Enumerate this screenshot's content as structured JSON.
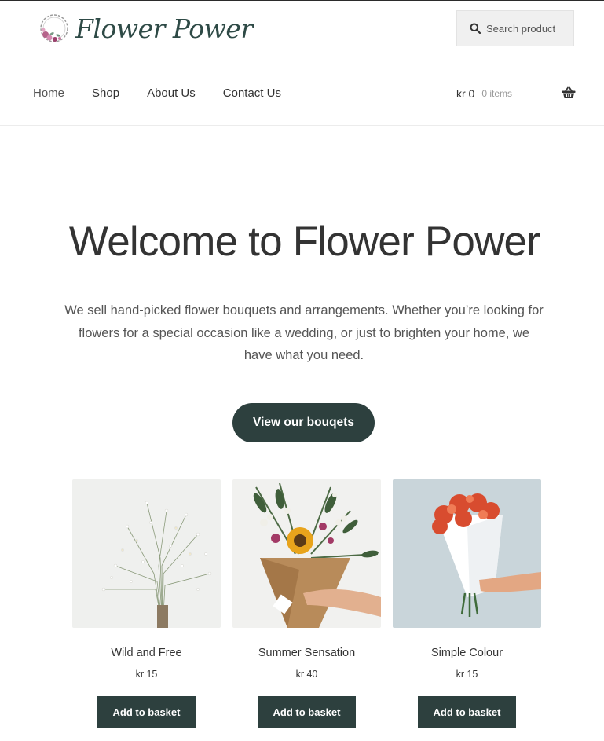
{
  "header": {
    "logo_text": "Flower Power",
    "search": {
      "placeholder": "Search product"
    },
    "nav": [
      {
        "label": "Home"
      },
      {
        "label": "Shop"
      },
      {
        "label": "About Us"
      },
      {
        "label": "Contact Us"
      }
    ],
    "cart": {
      "amount": "kr 0",
      "items": "0 items",
      "icon": "basket-icon"
    }
  },
  "hero": {
    "title": "Welcome to Flower Power",
    "text": "We sell hand-picked flower bouquets and arrangements. Whether you’re looking for flowers for a special occasion like a wedding, or just to brighten your home, we have what you need.",
    "button_label": "View our bouqets"
  },
  "products": [
    {
      "name": "Wild and Free",
      "price": "kr 15",
      "button_label": "Add to basket"
    },
    {
      "name": "Summer Sensation",
      "price": "kr 40",
      "button_label": "Add to basket"
    },
    {
      "name": "Simple Colour",
      "price": "kr 15",
      "button_label": "Add to basket"
    }
  ],
  "colors": {
    "accent": "#2d403e",
    "text": "#333333",
    "muted": "#999999"
  }
}
